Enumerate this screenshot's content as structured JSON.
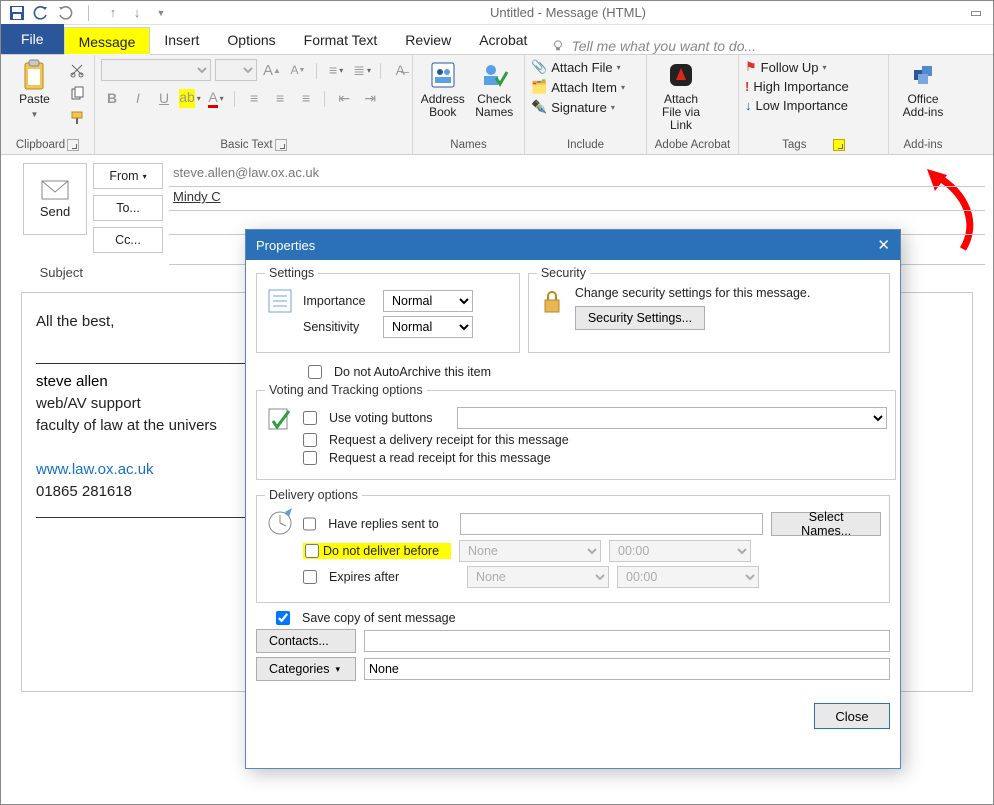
{
  "window": {
    "title": "Untitled - Message (HTML)"
  },
  "tabs": {
    "file": "File",
    "message": "Message",
    "insert": "Insert",
    "options": "Options",
    "format": "Format Text",
    "review": "Review",
    "acrobat": "Acrobat",
    "tellme": "Tell me what you want to do..."
  },
  "ribbon": {
    "clipboard": {
      "paste": "Paste",
      "label": "Clipboard"
    },
    "basictext": {
      "label": "Basic Text"
    },
    "names": {
      "address": "Address Book",
      "check": "Check Names",
      "label": "Names"
    },
    "include": {
      "attachfile": "Attach File",
      "attachitem": "Attach Item",
      "signature": "Signature",
      "label": "Include"
    },
    "adobe": {
      "attach": "Attach File via Link",
      "label": "Adobe Acrobat"
    },
    "tags": {
      "follow": "Follow Up",
      "high": "High Importance",
      "low": "Low Importance",
      "label": "Tags"
    },
    "addins": {
      "btn": "Office Add-ins",
      "label": "Add-ins"
    }
  },
  "compose": {
    "send": "Send",
    "from": "From",
    "from_value": "steve.allen@law.ox.ac.uk",
    "to": "To...",
    "to_value": "Mindy C",
    "cc": "Cc...",
    "subject": "Subject"
  },
  "body": {
    "greeting": "All the best,",
    "sig1": "steve allen",
    "sig2": "web/AV support",
    "sig3": "faculty of law at the univers",
    "url": "www.law.ox.ac.uk",
    "phone": "01865 281618"
  },
  "dialog": {
    "title": "Properties",
    "settings_legend": "Settings",
    "importance": "Importance",
    "importance_val": "Normal",
    "sensitivity": "Sensitivity",
    "sensitivity_val": "Normal",
    "autoarchive": "Do not AutoArchive this item",
    "security_legend": "Security",
    "security_text": "Change security settings for this message.",
    "security_btn": "Security Settings...",
    "voting_legend": "Voting and Tracking options",
    "voting": "Use voting buttons",
    "delivery_receipt": "Request a delivery receipt for this message",
    "read_receipt": "Request a read receipt for this message",
    "delivery_legend": "Delivery options",
    "replies": "Have replies sent to",
    "selectnames": "Select Names...",
    "donotdeliver": "Do not deliver before",
    "date_none": "None",
    "time_zero": "00:00",
    "expires": "Expires after",
    "savecopy": "Save copy of sent message",
    "contacts": "Contacts...",
    "categories": "Categories",
    "categories_val": "None",
    "close": "Close"
  }
}
